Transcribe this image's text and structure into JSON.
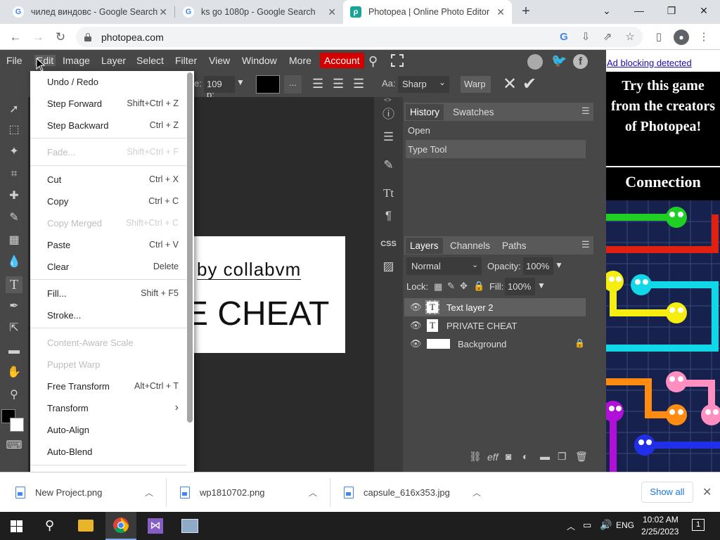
{
  "browser": {
    "tabs": [
      {
        "title": "чилед виндовс - Google Search",
        "favicon": "google-icon"
      },
      {
        "title": "ks go 1080p - Google Search",
        "favicon": "google-icon"
      },
      {
        "title": "Photopea | Online Photo Editor",
        "favicon": "photopea-icon"
      }
    ],
    "url": "photopea.com"
  },
  "menubar": {
    "items": [
      "File",
      "Edit",
      "Image",
      "Layer",
      "Select",
      "Filter",
      "View",
      "Window",
      "More"
    ],
    "account": "Account"
  },
  "options": {
    "size_label": "e:",
    "size_value": "109 p:",
    "more": "...",
    "aa_label": "Aa:",
    "aa_value": "Sharp",
    "warp": "Warp"
  },
  "canvas": {
    "line1": "by collabvm",
    "line2": "E CHEAT"
  },
  "edit_menu": [
    {
      "label": "Undo / Redo",
      "shortcut": "",
      "disabled": false
    },
    {
      "label": "Step Forward",
      "shortcut": "Shift+Ctrl + Z",
      "disabled": false
    },
    {
      "label": "Step Backward",
      "shortcut": "Ctrl + Z",
      "disabled": false
    },
    {
      "label": "Fade...",
      "shortcut": "Shift+Ctrl + F",
      "disabled": true
    },
    {
      "label": "Cut",
      "shortcut": "Ctrl + X",
      "disabled": false
    },
    {
      "label": "Copy",
      "shortcut": "Ctrl + C",
      "disabled": false
    },
    {
      "label": "Copy Merged",
      "shortcut": "Shift+Ctrl + C",
      "disabled": true
    },
    {
      "label": "Paste",
      "shortcut": "Ctrl + V",
      "disabled": false
    },
    {
      "label": "Clear",
      "shortcut": "Delete",
      "disabled": false
    },
    {
      "label": "Fill...",
      "shortcut": "Shift + F5",
      "disabled": false
    },
    {
      "label": "Stroke...",
      "shortcut": "",
      "disabled": false
    },
    {
      "label": "Content-Aware Scale",
      "shortcut": "",
      "disabled": true
    },
    {
      "label": "Puppet Warp",
      "shortcut": "",
      "disabled": true
    },
    {
      "label": "Free Transform",
      "shortcut": "Alt+Ctrl + T",
      "disabled": false
    },
    {
      "label": "Transform",
      "shortcut": "›",
      "disabled": false
    },
    {
      "label": "Auto-Align",
      "shortcut": "",
      "disabled": false
    },
    {
      "label": "Auto-Blend",
      "shortcut": "",
      "disabled": false
    }
  ],
  "history_panel": {
    "tabs": [
      "History",
      "Swatches"
    ],
    "items": [
      "Open",
      "Type Tool"
    ]
  },
  "layers_panel": {
    "tabs": [
      "Layers",
      "Channels",
      "Paths"
    ],
    "blend_mode": "Normal",
    "opacity_label": "Opacity:",
    "opacity": "100%",
    "lock_label": "Lock:",
    "fill_label": "Fill:",
    "fill": "100%",
    "layers": [
      {
        "name": "Text layer 2",
        "type": "text",
        "selected": true
      },
      {
        "name": "PRIVATE CHEAT",
        "type": "text",
        "selected": false
      },
      {
        "name": "Background",
        "type": "image",
        "selected": false
      }
    ],
    "bottom_icons": [
      "link-icon",
      "effects-icon",
      "mask-icon",
      "adjustment-icon",
      "folder-icon",
      "new-layer-icon",
      "trash-icon"
    ],
    "eff": "eff"
  },
  "ad": {
    "notice": "Ad blocking detected",
    "headline": "Try this game from the creators of Photopea!",
    "game": "Connection"
  },
  "downloads": {
    "items": [
      "New Project.png",
      "wp1810702.png",
      "capsule_616x353.jpg"
    ],
    "show_all": "Show all"
  },
  "taskbar": {
    "lang": "ENG",
    "time": "10:02 AM",
    "date": "2/25/2023",
    "notifications": "1"
  },
  "colors": {
    "photopea_bg": "#474747",
    "canvas_bg": "#2b2b2b",
    "account_red": "#d40000",
    "ad_navy": "#16214e"
  }
}
